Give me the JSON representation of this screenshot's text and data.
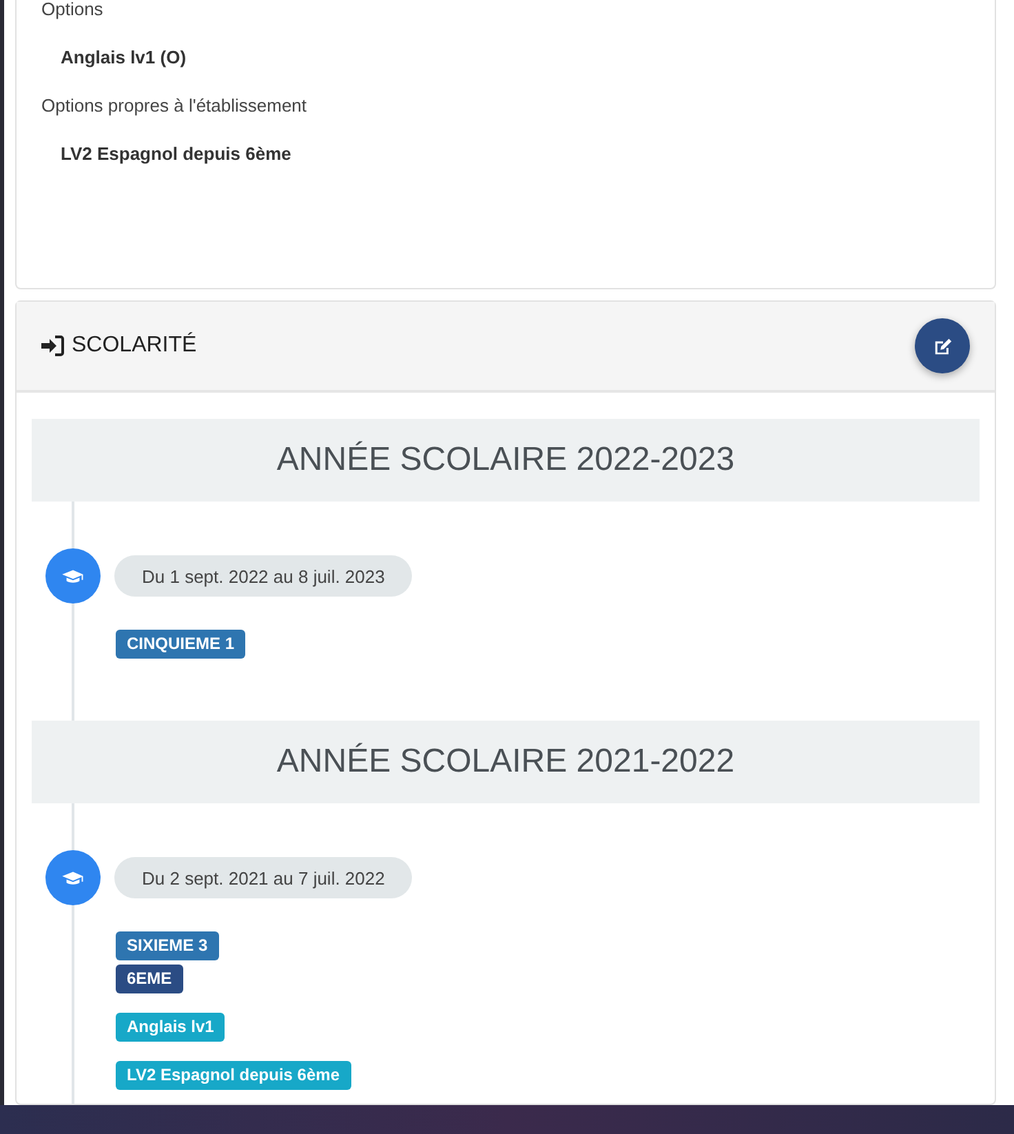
{
  "options_card": {
    "groups": [
      {
        "label": "Options",
        "items": [
          "Anglais lv1 (O)"
        ]
      },
      {
        "label": "Options propres à l'établissement",
        "items": [
          "LV2 Espagnol depuis 6ème"
        ]
      }
    ]
  },
  "schooling": {
    "title": "SCOLARITÉ",
    "years": [
      {
        "title": "ANNÉE SCOLAIRE 2022-2023",
        "period": "Du 1 sept. 2022 au 8 juil. 2023",
        "tag_groups": [
          [
            {
              "text": "CINQUIEME 1",
              "color": "#2e75b0"
            }
          ]
        ]
      },
      {
        "title": "ANNÉE SCOLAIRE 2021-2022",
        "period": "Du 2 sept. 2021 au 7 juil. 2022",
        "tag_groups": [
          [
            {
              "text": "SIXIEME 3",
              "color": "#2e75b0"
            },
            {
              "text": "6EME",
              "color": "#2b4c84"
            }
          ],
          [
            {
              "text": "Anglais lv1",
              "color": "#17a8c8"
            }
          ],
          [
            {
              "text": "LV2 Espagnol depuis 6ème",
              "color": "#17a8c8"
            }
          ]
        ]
      }
    ]
  }
}
